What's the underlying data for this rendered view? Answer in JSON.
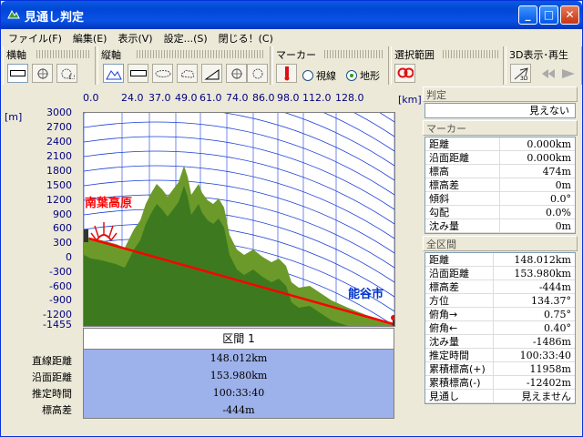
{
  "window": {
    "title": "見通し判定"
  },
  "menu": [
    "ファイル(F)",
    "編集(E)",
    "表示(V)",
    "設定...(S)",
    "閉じる！(C)"
  ],
  "toolbars": {
    "horizontal_axis": "横軸",
    "vertical_axis": "縦軸",
    "marker": "マーカー",
    "selection": "選択範囲",
    "display3d": "3D表示･再生",
    "radio_visibility": "視線",
    "radio_terrain": "地形"
  },
  "plot": {
    "unit_y": "[m]",
    "unit_x": "[km]",
    "x_ticks": [
      "0.0",
      "24.0",
      "37.0",
      "49.0",
      "61.0",
      "74.0",
      "86.0",
      "98.0",
      "112.0",
      "128.0"
    ],
    "y_ticks": [
      "3000",
      "2700",
      "2400",
      "2100",
      "1800",
      "1500",
      "1200",
      "900",
      "600",
      "300",
      "0",
      "-300",
      "-600",
      "-900",
      "-1200",
      "-1455"
    ],
    "label_start": "南葉高原",
    "label_end": "能谷市",
    "colors": {
      "terrain": "#6b9a2a",
      "terrain_dark": "#3d7a1f",
      "line": "#ff0000",
      "curve": "#1a3dd8",
      "label_start": "#ff0000",
      "label_end": "#0033cc"
    }
  },
  "segment": {
    "header": "区間 1",
    "labels": [
      "直線距離",
      "沿面距離",
      "推定時間",
      "標高差"
    ],
    "values": [
      "148.012km",
      "153.980km",
      "100:33:40",
      "-444m"
    ]
  },
  "right": {
    "judgement_title": "判定",
    "judgement_value": "見えない",
    "marker_title": "マーカー",
    "marker_rows": [
      {
        "k": "距離",
        "v": "0.000km"
      },
      {
        "k": "沿面距離",
        "v": "0.000km"
      },
      {
        "k": "標高",
        "v": "474m"
      },
      {
        "k": "標高差",
        "v": "0m"
      },
      {
        "k": "傾斜",
        "v": "0.0°"
      },
      {
        "k": "勾配",
        "v": "0.0%"
      },
      {
        "k": "沈み量",
        "v": "0m"
      }
    ],
    "total_title": "全区間",
    "total_rows": [
      {
        "k": "距離",
        "v": "148.012km"
      },
      {
        "k": "沿面距離",
        "v": "153.980km"
      },
      {
        "k": "標高差",
        "v": "-444m"
      },
      {
        "k": "方位",
        "v": "134.37°"
      },
      {
        "k": "俯角→",
        "v": "0.75°"
      },
      {
        "k": "俯角←",
        "v": "0.40°"
      },
      {
        "k": "沈み量",
        "v": "-1486m"
      },
      {
        "k": "推定時間",
        "v": "100:33:40"
      },
      {
        "k": "累積標高(+)",
        "v": "11958m"
      },
      {
        "k": "累積標高(-)",
        "v": "-12402m"
      },
      {
        "k": "見通し",
        "v": "見えません"
      }
    ]
  }
}
